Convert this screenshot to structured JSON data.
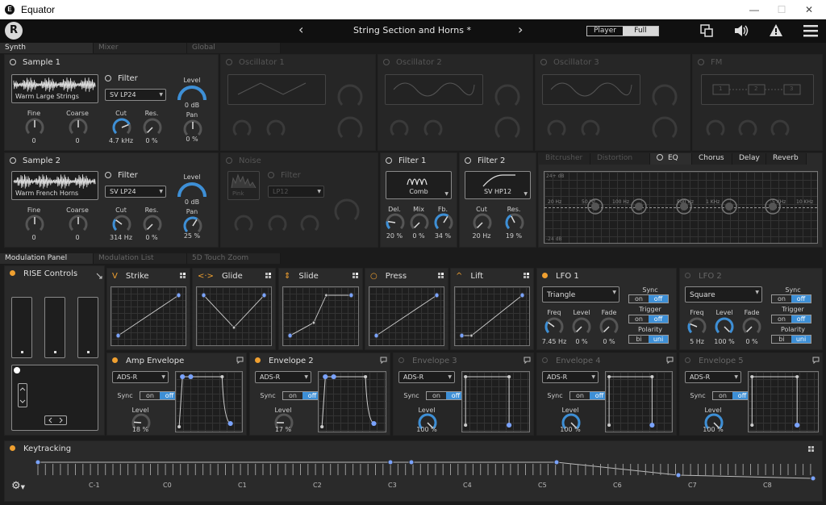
{
  "window": {
    "title": "Equator",
    "icon": "E",
    "minimize": "—",
    "maximize": "☐",
    "close": "✕"
  },
  "topbar": {
    "logo": "R",
    "preset": "String Section and Horns *",
    "prev": "‹",
    "next": "›",
    "mode_player": "Player",
    "mode_full": "Full",
    "icons": [
      "resize-window-icon",
      "speaker-icon",
      "warning-icon",
      "menu-icon"
    ]
  },
  "tabs_top": [
    "Synth",
    "Mixer",
    "Global"
  ],
  "sample1": {
    "title": "Sample 1",
    "wave": "Warm Large Strings",
    "filter_title": "Filter",
    "filter_type": "SV LP24",
    "level_label": "Level",
    "level_val": "0 dB",
    "fine_label": "Fine",
    "fine_val": "0",
    "coarse_label": "Coarse",
    "coarse_val": "0",
    "cut_label": "Cut",
    "cut_val": "4.7 kHz",
    "res_label": "Res.",
    "res_val": "0 %",
    "pan_label": "Pan",
    "pan_val": "0 %"
  },
  "sample2": {
    "title": "Sample 2",
    "wave": "Warm French Horns",
    "filter_title": "Filter",
    "filter_type": "SV LP24",
    "level_label": "Level",
    "level_val": "0 dB",
    "fine_label": "Fine",
    "fine_val": "0",
    "coarse_label": "Coarse",
    "coarse_val": "0",
    "cut_label": "Cut",
    "cut_val": "314 Hz",
    "res_label": "Res.",
    "res_val": "0 %",
    "pan_label": "Pan",
    "pan_val": "25 %"
  },
  "osc": [
    "Oscillator 1",
    "Oscillator 2",
    "Oscillator 3"
  ],
  "fm": {
    "title": "FM",
    "nodes": [
      "1",
      "2",
      "3"
    ]
  },
  "noise": {
    "title": "Noise",
    "color": "Pink",
    "filter_title": "Filter",
    "filter_type": "LP12"
  },
  "filter1": {
    "title": "Filter 1",
    "type": "Comb",
    "del_label": "Del.",
    "del_val": "20 %",
    "mix_label": "Mix",
    "mix_val": "0 %",
    "fb_label": "Fb.",
    "fb_val": "34 %"
  },
  "filter2": {
    "title": "Filter 2",
    "type": "SV HP12",
    "cut_label": "Cut",
    "cut_val": "20 Hz",
    "res_label": "Res.",
    "res_val": "19 %"
  },
  "fx_tabs": [
    "Bitcrusher",
    "Distortion",
    "EQ",
    "Chorus",
    "Delay",
    "Reverb"
  ],
  "eq": {
    "top": "24+ dB",
    "bottom": "-24 dB",
    "freqs": [
      "20 Hz",
      "50 Hz",
      "100 Hz",
      "500 Hz",
      "1 KHz",
      "5 KHz",
      "10 KHz"
    ]
  },
  "tabs_mod": [
    "Modulation Panel",
    "Modulation List",
    "5D Touch Zoom"
  ],
  "rise": {
    "title": "RISE Controls"
  },
  "dims": [
    {
      "title": "Strike",
      "icon": "V"
    },
    {
      "title": "Glide",
      "icon": "<·>"
    },
    {
      "title": "Slide",
      "icon": "⇕"
    },
    {
      "title": "Press",
      "icon": "○"
    },
    {
      "title": "Lift",
      "icon": "^"
    }
  ],
  "lfo1": {
    "title": "LFO 1",
    "shape": "Triangle",
    "sync": "Sync",
    "trigger": "Trigger",
    "polarity": "Polarity",
    "on": "on",
    "off": "off",
    "bi": "bi",
    "uni": "uni",
    "freq_label": "Freq",
    "freq_val": "7.45 Hz",
    "level_label": "Level",
    "level_val": "0 %",
    "fade_label": "Fade",
    "fade_val": "0 %"
  },
  "lfo2": {
    "title": "LFO 2",
    "shape": "Square",
    "sync": "Sync",
    "trigger": "Trigger",
    "polarity": "Polarity",
    "on": "on",
    "off": "off",
    "bi": "bi",
    "uni": "uni",
    "freq_label": "Freq",
    "freq_val": "5 Hz",
    "level_label": "Level",
    "level_val": "100 %",
    "fade_label": "Fade",
    "fade_val": "0 %"
  },
  "envs": [
    {
      "title": "Amp Envelope",
      "mode": "ADS-R",
      "sync": "Sync",
      "on": "on",
      "off": "off",
      "level_label": "Level",
      "level_val": "18 %",
      "active": true
    },
    {
      "title": "Envelope 2",
      "mode": "ADS-R",
      "sync": "Sync",
      "on": "on",
      "off": "off",
      "level_label": "Level",
      "level_val": "17 %",
      "active": true
    },
    {
      "title": "Envelope 3",
      "mode": "ADS-R",
      "sync": "Sync",
      "on": "on",
      "off": "off",
      "level_label": "Level",
      "level_val": "100 %",
      "active": false
    },
    {
      "title": "Envelope 4",
      "mode": "ADS-R",
      "sync": "Sync",
      "on": "on",
      "off": "off",
      "level_label": "Level",
      "level_val": "100 %",
      "active": false
    },
    {
      "title": "Envelope 5",
      "mode": "ADS-R",
      "sync": "Sync",
      "on": "on",
      "off": "off",
      "level_label": "Level",
      "level_val": "100 %",
      "active": false
    }
  ],
  "keytracking": {
    "title": "Keytracking",
    "octaves": [
      "C-1",
      "C0",
      "C1",
      "C2",
      "C3",
      "C4",
      "C5",
      "C6",
      "C7",
      "C8"
    ]
  },
  "colors": {
    "accent": "#3d8fd6",
    "dot": "#f0a030"
  }
}
